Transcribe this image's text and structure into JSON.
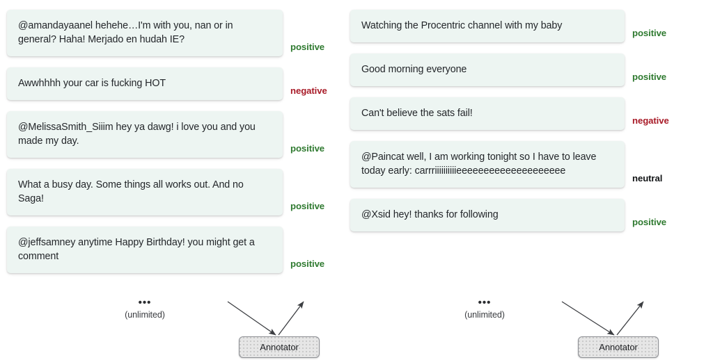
{
  "columns": [
    {
      "name": "left-column",
      "items": [
        {
          "text": "@amandayaanel hehehe…I'm with you, nan or in general? Haha! Merjado en hudah IE?",
          "label": "positive",
          "sentiment": "positive"
        },
        {
          "text": "Awwhhhh your car is fucking HOT",
          "label": "negative",
          "sentiment": "negative"
        },
        {
          "text": "@MelissaSmith_Siiim hey ya dawg! i love you and you made my day.",
          "label": "positive",
          "sentiment": "positive"
        },
        {
          "text": "What a busy day. Some things all works out. And no Saga!",
          "label": "positive",
          "sentiment": "positive"
        },
        {
          "text": "@jeffsamney anytime Happy Birthday! you might get a comment",
          "label": "positive",
          "sentiment": "positive"
        }
      ],
      "ellipsis": "•••",
      "unlimited_label": "(unlimited)",
      "annotator_label": "Annotator"
    },
    {
      "name": "right-column",
      "items": [
        {
          "text": "Watching the Procentric channel with my baby",
          "label": "positive",
          "sentiment": "positive"
        },
        {
          "text": "Good morning everyone",
          "label": "positive",
          "sentiment": "positive"
        },
        {
          "text": "Can't believe the sats fail!",
          "label": "negative",
          "sentiment": "negative"
        },
        {
          "text": "@Paincat well, I am working tonight so I have to leave today early: carrriiiiiiiiiieeeeeeeeeeeeeeeeeeee",
          "label": "neutral",
          "sentiment": "neutral"
        },
        {
          "text": "@Xsid hey! thanks for following",
          "label": "positive",
          "sentiment": "positive"
        }
      ],
      "ellipsis": "•••",
      "unlimited_label": "(unlimited)",
      "annotator_label": "Annotator"
    }
  ],
  "colors": {
    "positive": "#2f7a30",
    "negative": "#a81b28",
    "neutral": "#121416",
    "card_background": "#edf5f2",
    "annotator_background": "#e6e6e6",
    "arrow": "#3c3e42"
  }
}
